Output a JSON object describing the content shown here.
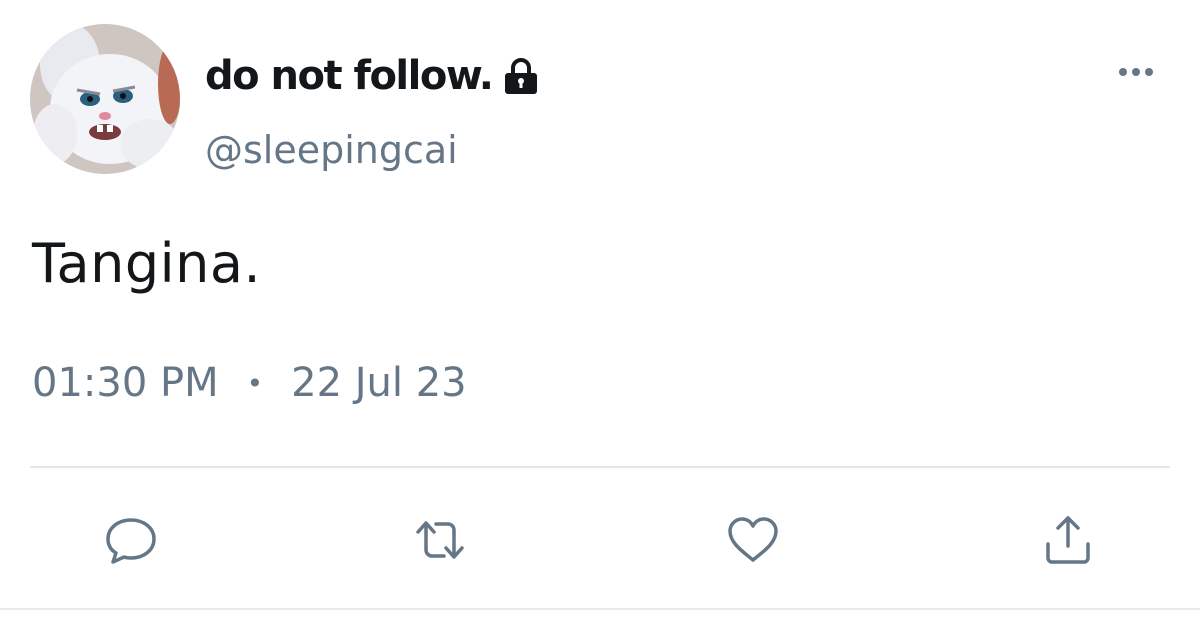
{
  "tweet": {
    "display_name": "do not follow.",
    "handle": "@sleepingcai",
    "text": "Tangina.",
    "time": "01:30 PM",
    "separator": "•",
    "date": "22 Jul 23",
    "protected": true
  },
  "icons": {
    "lock": "lock-icon",
    "more": "more-horizontal-icon",
    "reply": "reply-icon",
    "retweet": "retweet-icon",
    "like": "heart-icon",
    "share": "share-icon"
  },
  "colors": {
    "text_primary": "#14171a",
    "text_secondary": "#657786",
    "divider": "#e1e8ed"
  }
}
